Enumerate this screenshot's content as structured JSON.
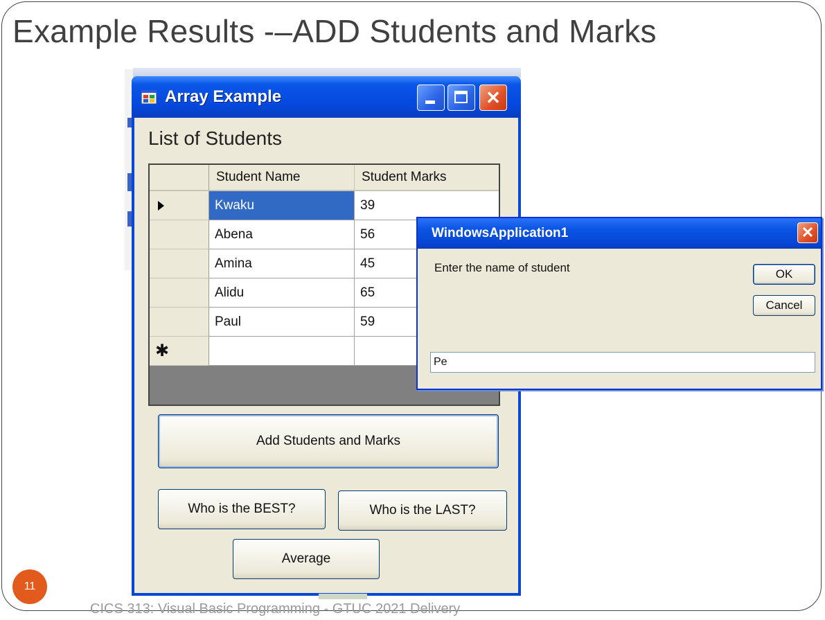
{
  "slide": {
    "title": "Example Results -–ADD Students and Marks",
    "number": "11",
    "footer": "CICS 313: Visual Basic Programming - GTUC 2021 Delivery"
  },
  "main_window": {
    "title": "Array Example",
    "list_label": "List of Students",
    "grid": {
      "columns": [
        "Student Name",
        "Student Marks"
      ],
      "rows": [
        {
          "name": "Kwaku",
          "marks": "39"
        },
        {
          "name": "Abena",
          "marks": "56"
        },
        {
          "name": "Amina",
          "marks": "45"
        },
        {
          "name": "Alidu",
          "marks": "65"
        },
        {
          "name": "Paul",
          "marks": "59"
        }
      ],
      "new_row_glyph": "✱"
    },
    "buttons": {
      "add": "Add Students and Marks",
      "best": "Who is the BEST?",
      "last": "Who is the LAST?",
      "average": "Average"
    }
  },
  "dialog": {
    "title": "WindowsApplication1",
    "prompt": "Enter the name of student",
    "ok": "OK",
    "cancel": "Cancel",
    "input_value": "Pe"
  },
  "colors": {
    "xp_titlebar": "#0548de",
    "selection": "#316ac5",
    "slide_number_bg": "#e25a1c"
  }
}
